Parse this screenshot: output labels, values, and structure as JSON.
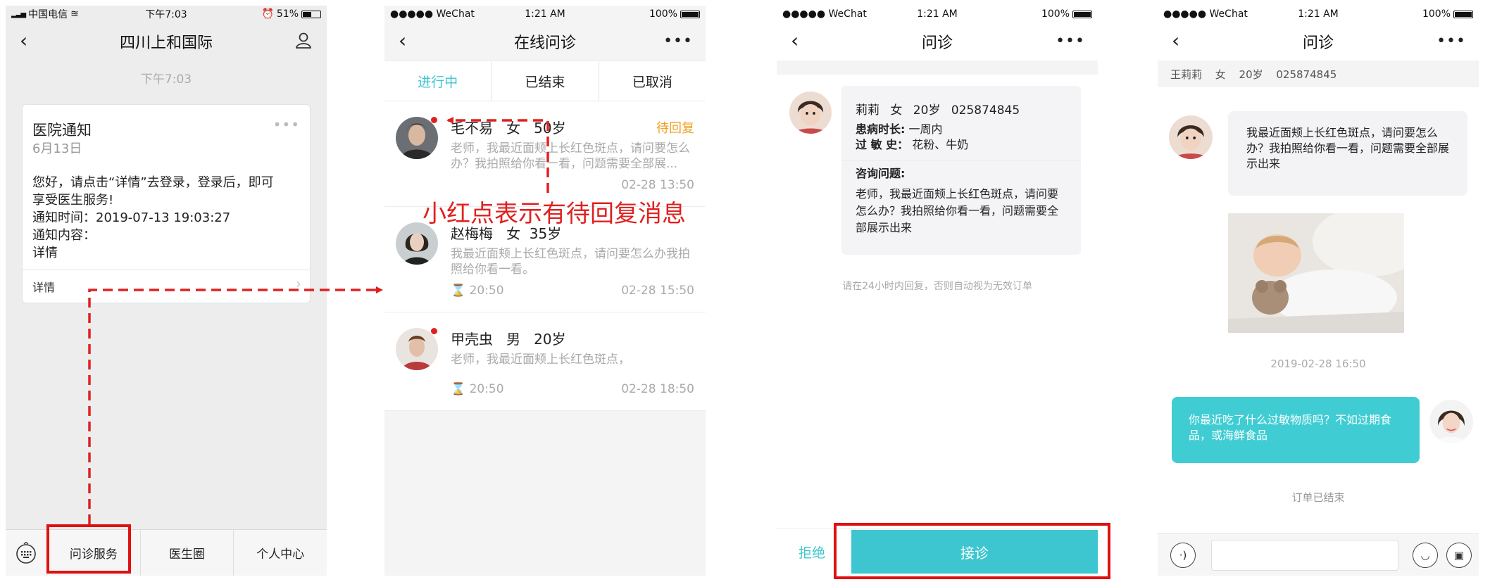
{
  "phone1": {
    "status": {
      "carrier": "中国电信",
      "time": "下午7:03",
      "battery": "51%"
    },
    "title": "四川上和国际",
    "timebar": "下午7:03",
    "card": {
      "title": "医院通知",
      "date": "6月13日",
      "body": [
        "您好，请点击“详情”去登录，登录后，即可",
        "享受医生服务!",
        "通知时间：2019-07-13 19:03:27",
        "通知内容：",
        "详情"
      ],
      "footer": "详情"
    },
    "tabs": [
      "问诊服务",
      "医生圈",
      "个人中心"
    ]
  },
  "phone2": {
    "status": {
      "carrier": "●●●●● WeChat",
      "time": "1:21 AM",
      "battery": "100%"
    },
    "title": "在线问诊",
    "tabs": [
      "进行中",
      "已结束",
      "已取消"
    ],
    "patients": [
      {
        "name": "毛不易",
        "gender": "女",
        "age": "50岁",
        "status": "待回复",
        "message": "老师，我最近面颊上长红色斑点，请问要怎么办？我拍照给你看一看，问题需要全部展...",
        "timer": "",
        "date": "02-28 13:50",
        "unread": true
      },
      {
        "name": "赵梅梅",
        "gender": "女",
        "age": "35岁",
        "status": "",
        "message": "我最近面颊上长红色斑点，请问要怎么办我拍照给你看一看。",
        "timer": "⌛ 20:50",
        "date": "02-28 15:50",
        "unread": false
      },
      {
        "name": "甲壳虫",
        "gender": "男",
        "age": "20岁",
        "status": "",
        "message": "老师，我最近面颊上长红色斑点，",
        "timer": "⌛ 20:50",
        "date": "02-28 18:50",
        "unread": true
      }
    ]
  },
  "annotation": "小红点表示有待回复消息",
  "phone3": {
    "status": {
      "carrier": "●●●●● WeChat",
      "time": "1:21 AM",
      "battery": "100%"
    },
    "title": "问诊",
    "patient_info": "莉莉 女 20岁 025874845",
    "duration_label": "患病时长:",
    "duration_value": "一周内",
    "allergy_label": "过 敏 史：",
    "allergy_value": "花粉、牛奶",
    "question_label": "咨询问题:",
    "question": "老师，我最近面颊上长红色斑点，请问要怎么办？我拍照给你看一看，问题需要全部展示出来",
    "hint": "请在24小时内回复，否则自动视为无效订单",
    "reject": "拒绝",
    "accept": "接诊"
  },
  "phone4": {
    "status": {
      "carrier": "●●●●● WeChat",
      "time": "1:21 AM",
      "battery": "100%"
    },
    "title": "问诊",
    "patient_info": "王莉莉 女 20岁 025874845",
    "incoming": "我最近面颊上长红色斑点，请问要怎么办？我拍照给你看一看，问题需要全部展示出来",
    "timestamp": "2019-02-28  16:50",
    "outgoing": "你最近吃了什么过敏物质吗？不如过期食品，或海鲜食品",
    "ended": "订单已结束"
  },
  "colors": {
    "accent": "#3dc6cf",
    "annotation_red": "#e02020",
    "pending": "#f0a020"
  }
}
